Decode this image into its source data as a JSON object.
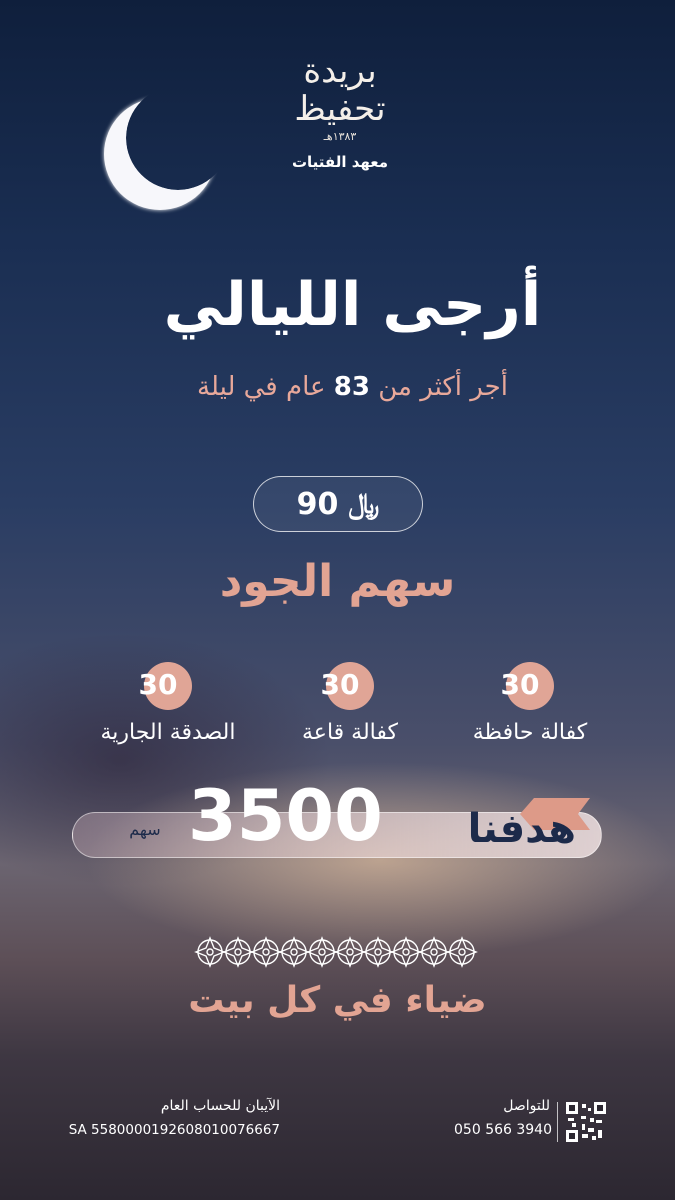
{
  "logo": {
    "calligraphy": "بريدة تحفيظ",
    "year": "١٣٨٣هـ",
    "institute": "معهد الفتيات"
  },
  "title": "أرجى الليالي",
  "subtitle": {
    "before": "أجر أكثر من ",
    "number": "83",
    "after": " عام في ليلة"
  },
  "price": {
    "amount": "90",
    "currency_symbol": "﷼"
  },
  "share_name": "سهم الجود",
  "items": [
    {
      "value": "30",
      "label": "كفالة حافظة"
    },
    {
      "value": "30",
      "label": "كفالة قاعة"
    },
    {
      "value": "30",
      "label": "الصدقة الجارية"
    }
  ],
  "goal": {
    "label": "هدفنا",
    "number": "3500",
    "unit": "سهم"
  },
  "slogan": "ضياء في كل بيت",
  "footer": {
    "contact_label": "للتواصل",
    "phone": "050 566 3940",
    "account_label": "الآيبان للحساب العام",
    "iban": "SA 5580000192608010076667"
  },
  "colors": {
    "accent": "#e2a493",
    "navy": "#1c2a4a"
  }
}
